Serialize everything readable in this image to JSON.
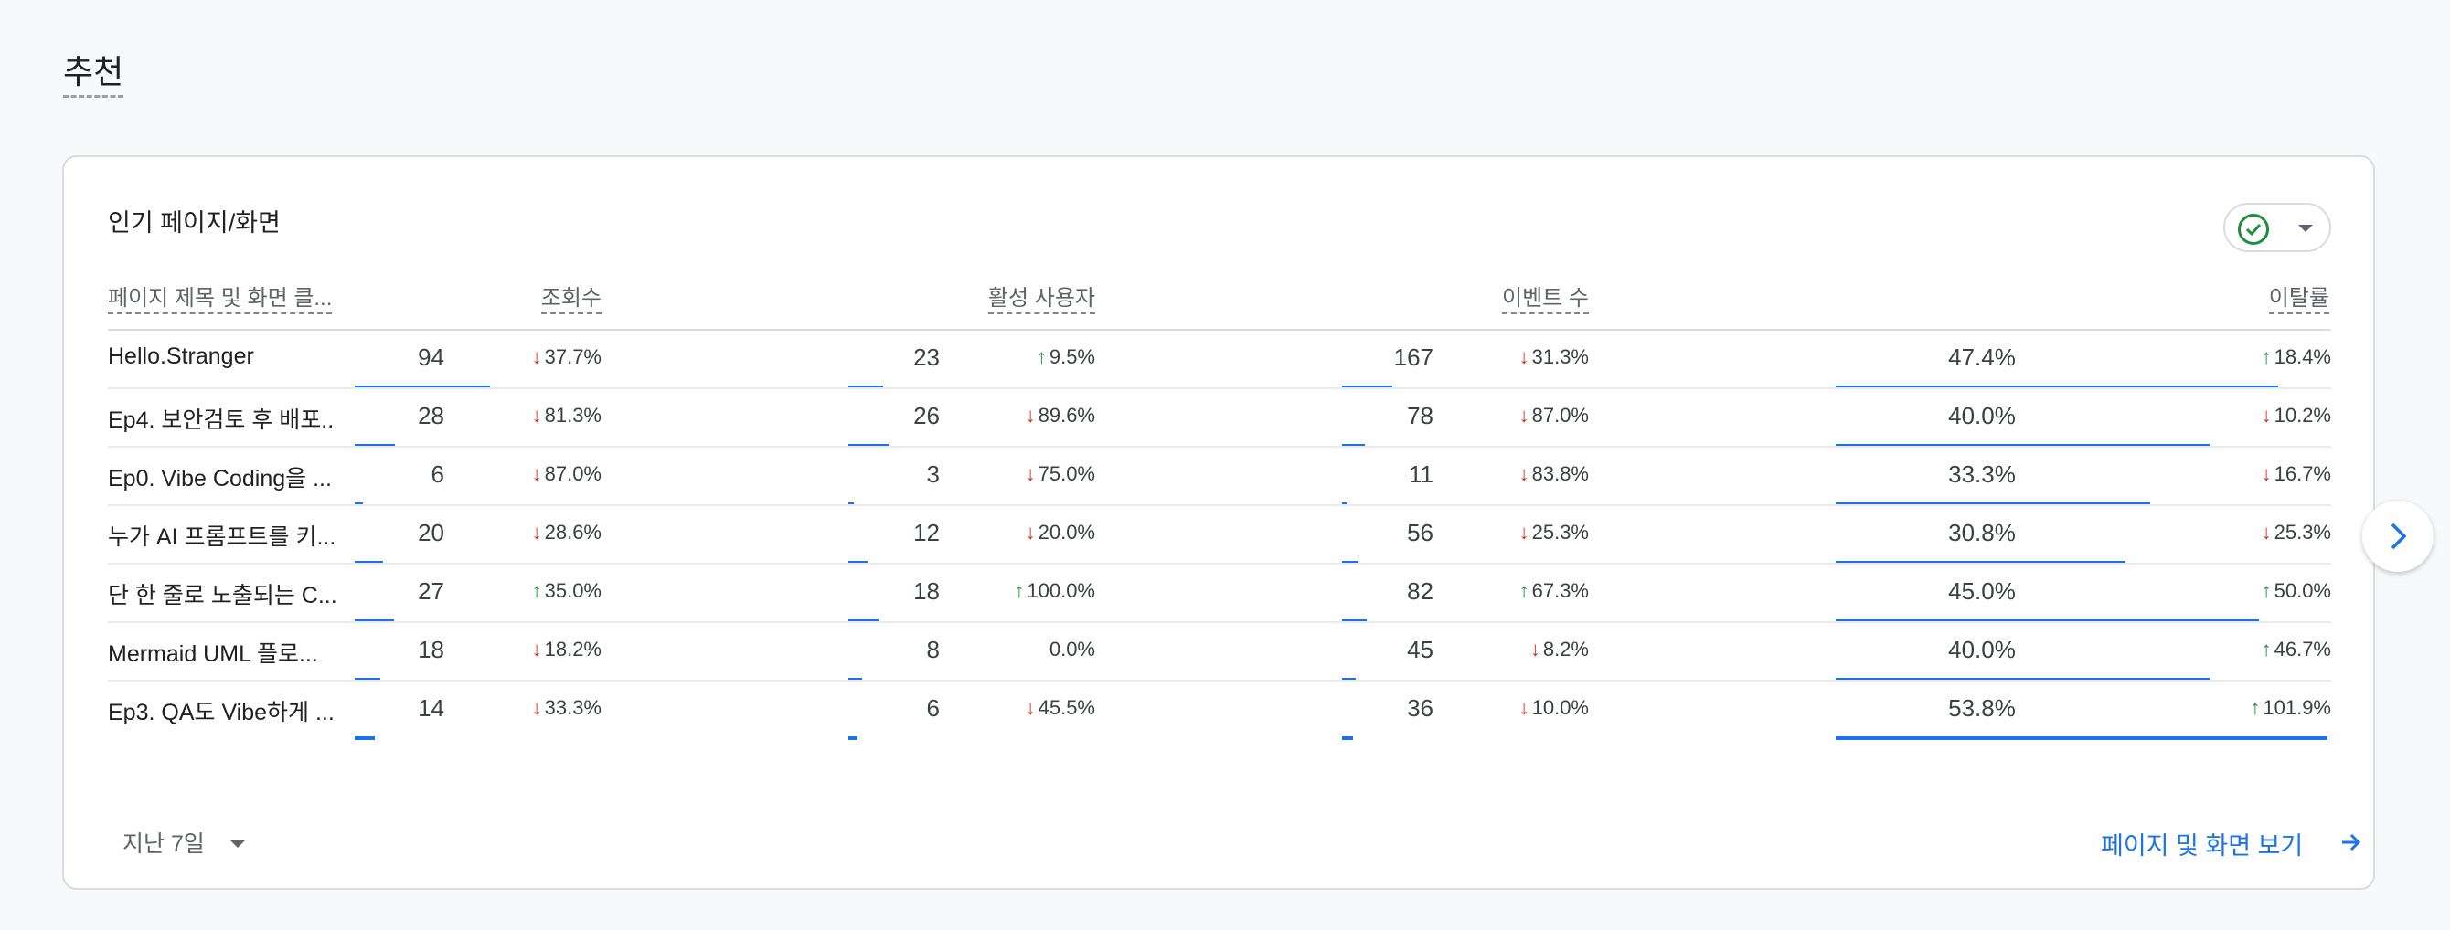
{
  "section": {
    "title": "추천"
  },
  "card": {
    "title": "인기 페이지/화면",
    "columns": {
      "title": "페이지 제목 및 화면 클...",
      "views": "조회수",
      "users": "활성 사용자",
      "events": "이벤트 수",
      "bounce": "이탈률"
    },
    "rows": [
      {
        "title": "Hello.Stranger",
        "views": "94",
        "views_chg": "37.7%",
        "views_dir": "down",
        "views_bar": 1.0,
        "users": "23",
        "users_chg": "9.5%",
        "users_dir": "up",
        "users_bar": 0.26,
        "events": "167",
        "events_chg": "31.3%",
        "events_dir": "down",
        "events_bar": 0.37,
        "bounce": "47.4%",
        "bounce_chg": "18.4%",
        "bounce_dir": "up",
        "bounce_bar": 0.9
      },
      {
        "title": "Ep4. 보안검토 후 배포...",
        "views": "28",
        "views_chg": "81.3%",
        "views_dir": "down",
        "views_bar": 0.3,
        "users": "26",
        "users_chg": "89.6%",
        "users_dir": "down",
        "users_bar": 0.3,
        "events": "78",
        "events_chg": "87.0%",
        "events_dir": "down",
        "events_bar": 0.17,
        "bounce": "40.0%",
        "bounce_chg": "10.2%",
        "bounce_dir": "down",
        "bounce_bar": 0.76
      },
      {
        "title": "Ep0. Vibe Coding을 ...",
        "views": "6",
        "views_chg": "87.0%",
        "views_dir": "down",
        "views_bar": 0.06,
        "users": "3",
        "users_chg": "75.0%",
        "users_dir": "down",
        "users_bar": 0.03,
        "events": "11",
        "events_chg": "83.8%",
        "events_dir": "down",
        "events_bar": 0.02,
        "bounce": "33.3%",
        "bounce_chg": "16.7%",
        "bounce_dir": "down",
        "bounce_bar": 0.64
      },
      {
        "title": "누가 AI 프롬프트를 키...",
        "views": "20",
        "views_chg": "28.6%",
        "views_dir": "down",
        "views_bar": 0.21,
        "users": "12",
        "users_chg": "20.0%",
        "users_dir": "down",
        "users_bar": 0.14,
        "events": "56",
        "events_chg": "25.3%",
        "events_dir": "down",
        "events_bar": 0.12,
        "bounce": "30.8%",
        "bounce_chg": "25.3%",
        "bounce_dir": "down",
        "bounce_bar": 0.59
      },
      {
        "title": "단 한 줄로 노출되는 C...",
        "views": "27",
        "views_chg": "35.0%",
        "views_dir": "up",
        "views_bar": 0.29,
        "users": "18",
        "users_chg": "100.0%",
        "users_dir": "up",
        "users_bar": 0.22,
        "events": "82",
        "events_chg": "67.3%",
        "events_dir": "up",
        "events_bar": 0.18,
        "bounce": "45.0%",
        "bounce_chg": "50.0%",
        "bounce_dir": "up",
        "bounce_bar": 0.86
      },
      {
        "title": "Mermaid UML 플로...",
        "views": "18",
        "views_chg": "18.2%",
        "views_dir": "down",
        "views_bar": 0.19,
        "users": "8",
        "users_chg": "0.0%",
        "users_dir": "none",
        "users_bar": 0.1,
        "events": "45",
        "events_chg": "8.2%",
        "events_dir": "down",
        "events_bar": 0.1,
        "bounce": "40.0%",
        "bounce_chg": "46.7%",
        "bounce_dir": "up",
        "bounce_bar": 0.76
      },
      {
        "title": "Ep3. QA도 Vibe하게 ...",
        "views": "14",
        "views_chg": "33.3%",
        "views_dir": "down",
        "views_bar": 0.15,
        "users": "6",
        "users_chg": "45.5%",
        "users_dir": "down",
        "users_bar": 0.07,
        "events": "36",
        "events_chg": "10.0%",
        "events_dir": "down",
        "events_bar": 0.08,
        "bounce": "53.8%",
        "bounce_chg": "101.9%",
        "bounce_dir": "up",
        "bounce_bar": 1.0
      }
    ],
    "footer": {
      "range_label": "지난 7일",
      "view_link": "페이지 및 화면 보기"
    }
  },
  "icons": {
    "compare": "check-circle-icon",
    "next": "chevron-right-icon",
    "link": "arrow-right-icon"
  },
  "colors": {
    "accent": "#1a73e8",
    "down": "#d93025",
    "up": "#1e8e3e"
  }
}
